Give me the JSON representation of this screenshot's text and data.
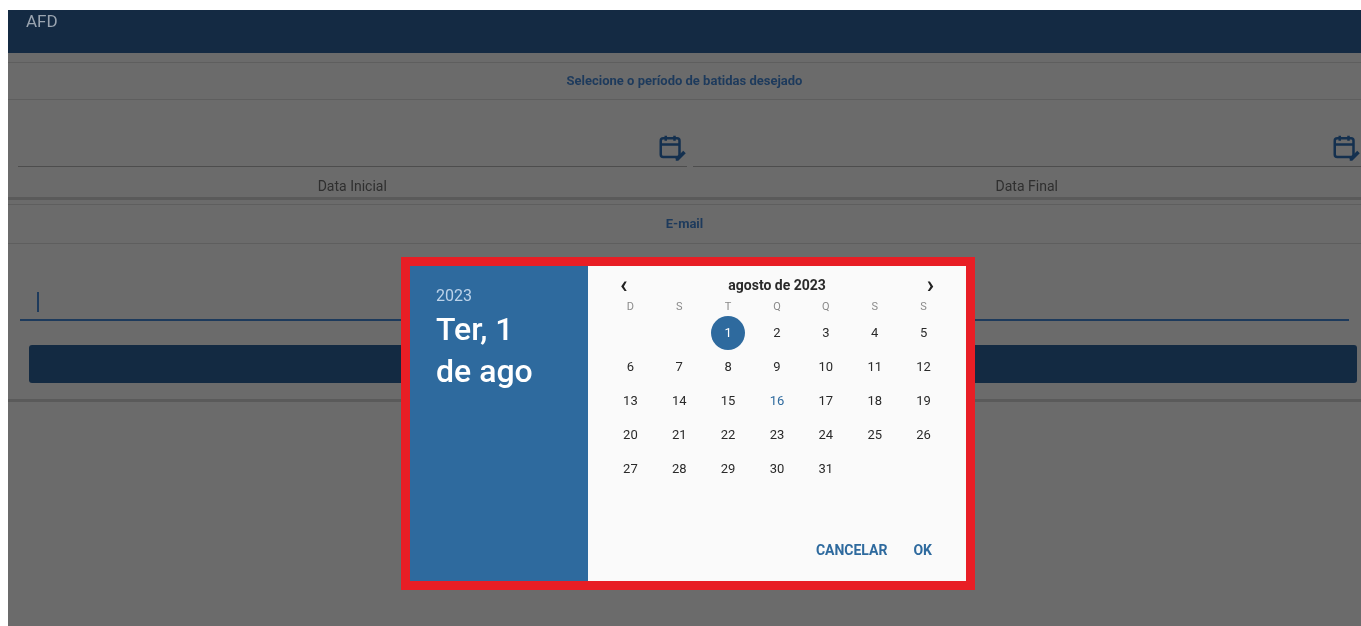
{
  "header": {
    "title": "AFD"
  },
  "period_section": {
    "title": "Selecione o período de batidas desejado",
    "fields": [
      {
        "label": "Data Inicial"
      },
      {
        "label": "Data Final"
      }
    ]
  },
  "email_section": {
    "title": "E-mail"
  },
  "date_picker": {
    "year": "2023",
    "date_line_1": "Ter, 1",
    "date_line_2": "de ago",
    "prev": "‹",
    "month": "agosto de 2023",
    "next": "›",
    "weekdays": [
      "D",
      "S",
      "T",
      "Q",
      "Q",
      "S",
      "S"
    ],
    "weeks": [
      [
        {
          "label": "1",
          "selected": true,
          "today": false
        },
        {
          "label": "2",
          "selected": false,
          "today": false
        },
        {
          "label": "3",
          "selected": false,
          "today": false
        },
        {
          "label": "4",
          "selected": false,
          "today": false
        },
        {
          "label": "5",
          "selected": false,
          "today": false
        }
      ],
      [
        {
          "label": "6",
          "selected": false,
          "today": false
        },
        {
          "label": "7",
          "selected": false,
          "today": false
        },
        {
          "label": "8",
          "selected": false,
          "today": false
        },
        {
          "label": "9",
          "selected": false,
          "today": false
        },
        {
          "label": "10",
          "selected": false,
          "today": false
        },
        {
          "label": "11",
          "selected": false,
          "today": false
        },
        {
          "label": "12",
          "selected": false,
          "today": false
        }
      ],
      [
        {
          "label": "13",
          "selected": false,
          "today": false
        },
        {
          "label": "14",
          "selected": false,
          "today": false
        },
        {
          "label": "15",
          "selected": false,
          "today": false
        },
        {
          "label": "16",
          "selected": false,
          "today": true
        },
        {
          "label": "17",
          "selected": false,
          "today": false
        },
        {
          "label": "18",
          "selected": false,
          "today": false
        },
        {
          "label": "19",
          "selected": false,
          "today": false
        }
      ],
      [
        {
          "label": "20",
          "selected": false,
          "today": false
        },
        {
          "label": "21",
          "selected": false,
          "today": false
        },
        {
          "label": "22",
          "selected": false,
          "today": false
        },
        {
          "label": "23",
          "selected": false,
          "today": false
        },
        {
          "label": "24",
          "selected": false,
          "today": false
        },
        {
          "label": "25",
          "selected": false,
          "today": false
        },
        {
          "label": "26",
          "selected": false,
          "today": false
        }
      ],
      [
        {
          "label": "27",
          "selected": false,
          "today": false
        },
        {
          "label": "28",
          "selected": false,
          "today": false
        },
        {
          "label": "29",
          "selected": false,
          "today": false
        },
        {
          "label": "30",
          "selected": false,
          "today": false
        },
        {
          "label": "31",
          "selected": false,
          "today": false
        }
      ]
    ],
    "buttons": [
      "CANCELAR",
      "OK"
    ]
  }
}
